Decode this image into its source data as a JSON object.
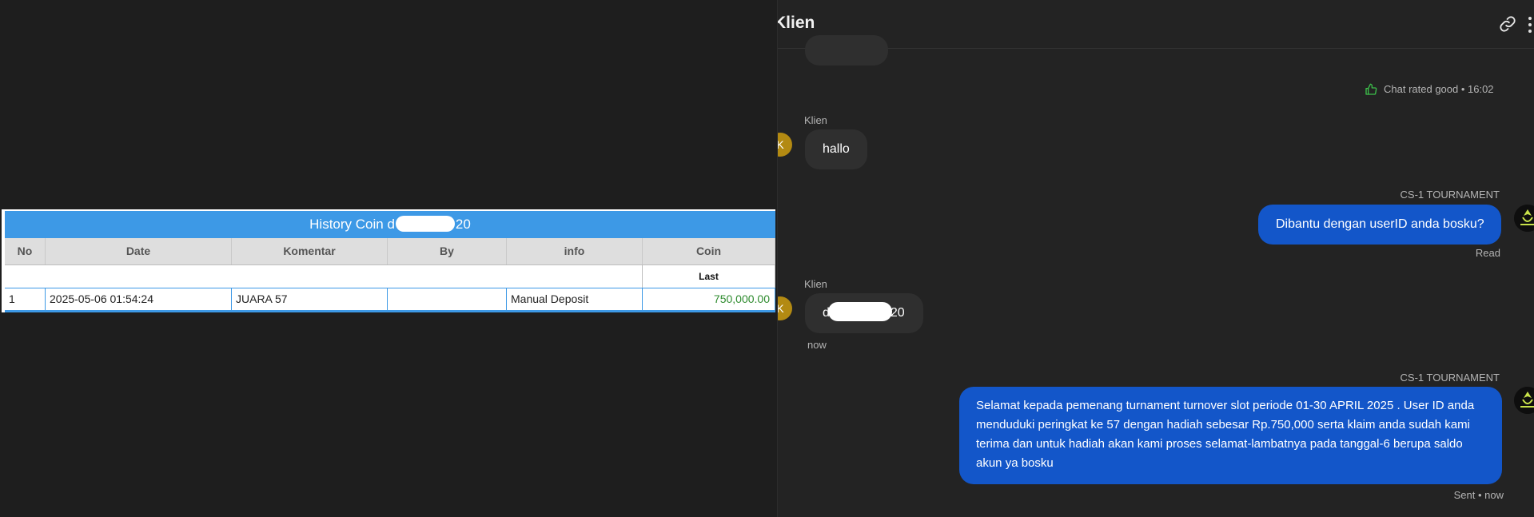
{
  "history": {
    "title_prefix": "History Coin d",
    "title_suffix": "20",
    "columns": [
      "No",
      "Date",
      "Komentar",
      "By",
      "info",
      "Coin"
    ],
    "subheader_coin": "Last",
    "rows": [
      {
        "no": "1",
        "date": "2025-05-06 01:54:24",
        "komentar": "JUARA 57",
        "by": "",
        "info": "Manual Deposit",
        "coin": "750,000.00"
      }
    ]
  },
  "chat": {
    "title": "Klien",
    "icons": [
      "link-icon",
      "more-icon",
      "thumbs-up-icon"
    ],
    "rating_text": "Chat rated good • 16:02",
    "messages": [
      {
        "sender": "Klien",
        "avatar": "K",
        "text": "hallo"
      },
      {
        "sender": "CS-1 TOURNAMENT",
        "text": "Dibantu dengan userID anda bosku?",
        "status": "Read"
      },
      {
        "sender": "Klien",
        "avatar": "K",
        "text_prefix": "d",
        "text_suffix": "20",
        "time": "now"
      },
      {
        "sender": "CS-1 TOURNAMENT",
        "text": "Selamat kepada pemenang turnament turnover slot periode 01-30 APRIL 2025 . User ID anda menduduki peringkat ke 57 dengan hadiah sebesar Rp.750,000 serta klaim anda sudah kami terima dan untuk hadiah akan kami proses selamat-lambatnya pada tanggal-6 berupa saldo akun ya bosku",
        "status": "Sent • now"
      }
    ],
    "colors": {
      "agent_bubble": "#1356c9",
      "client_bubble": "#2f2f2f",
      "avatar": "#b38a12",
      "rating_icon": "#3cbf4a",
      "coin_value": "#2e8b2e",
      "table_header": "#3d99e6"
    }
  }
}
